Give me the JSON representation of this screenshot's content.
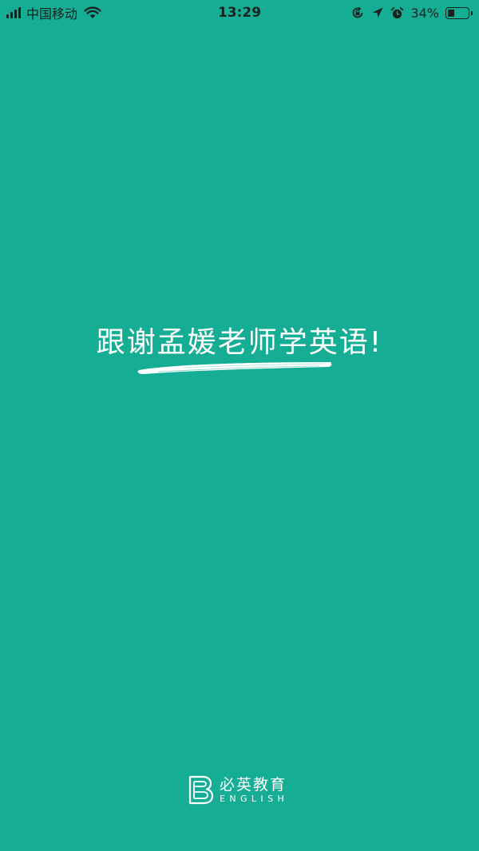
{
  "status_bar": {
    "carrier": "中国移动",
    "time": "13:29",
    "battery_percent": "34%",
    "battery_level": 0.34,
    "icons": [
      "signal-icon",
      "wifi-icon",
      "rotation-lock-icon",
      "location-arrow-icon",
      "alarm-icon",
      "battery-icon"
    ]
  },
  "splash": {
    "slogan": "跟谢孟媛老师学英语!"
  },
  "brand": {
    "name_cn": "必英教育",
    "name_en": "ENGLISH",
    "logo_icon": "b-letter-logo-icon"
  },
  "colors": {
    "background": "#15ae95",
    "foreground": "#ffffff",
    "status_text": "#16231f"
  }
}
